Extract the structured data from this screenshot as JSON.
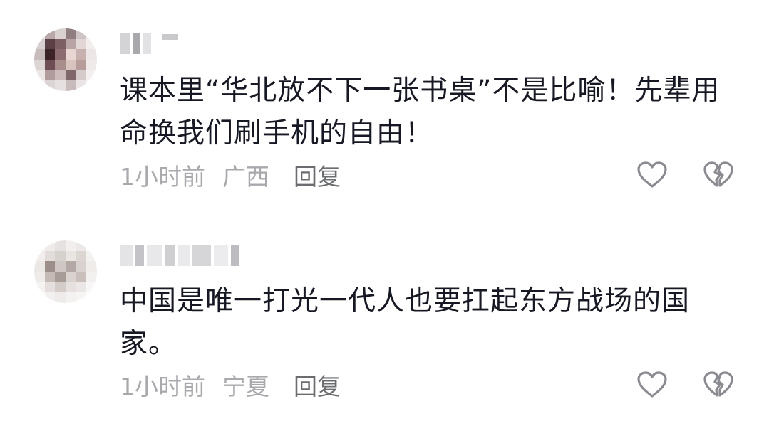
{
  "comments": [
    {
      "text": "课本里“华北放不下一张书桌”不是比喻！先辈用命换我们刷手机的自由！",
      "time": "1小时前",
      "location": "广西",
      "reply_label": "回复",
      "like_icon": "heart-outline-icon",
      "dislike_icon": "broken-heart-outline-icon"
    },
    {
      "text": "中国是唯一打光一代人也要扛起东方战场的国家。",
      "time": "1小时前",
      "location": "宁夏",
      "reply_label": "回复",
      "like_icon": "heart-outline-icon",
      "dislike_icon": "broken-heart-outline-icon"
    }
  ],
  "colors": {
    "text": "#161823",
    "meta": "#a8a9ad",
    "reply": "#6b6c70",
    "icon": "#8a8b91"
  }
}
